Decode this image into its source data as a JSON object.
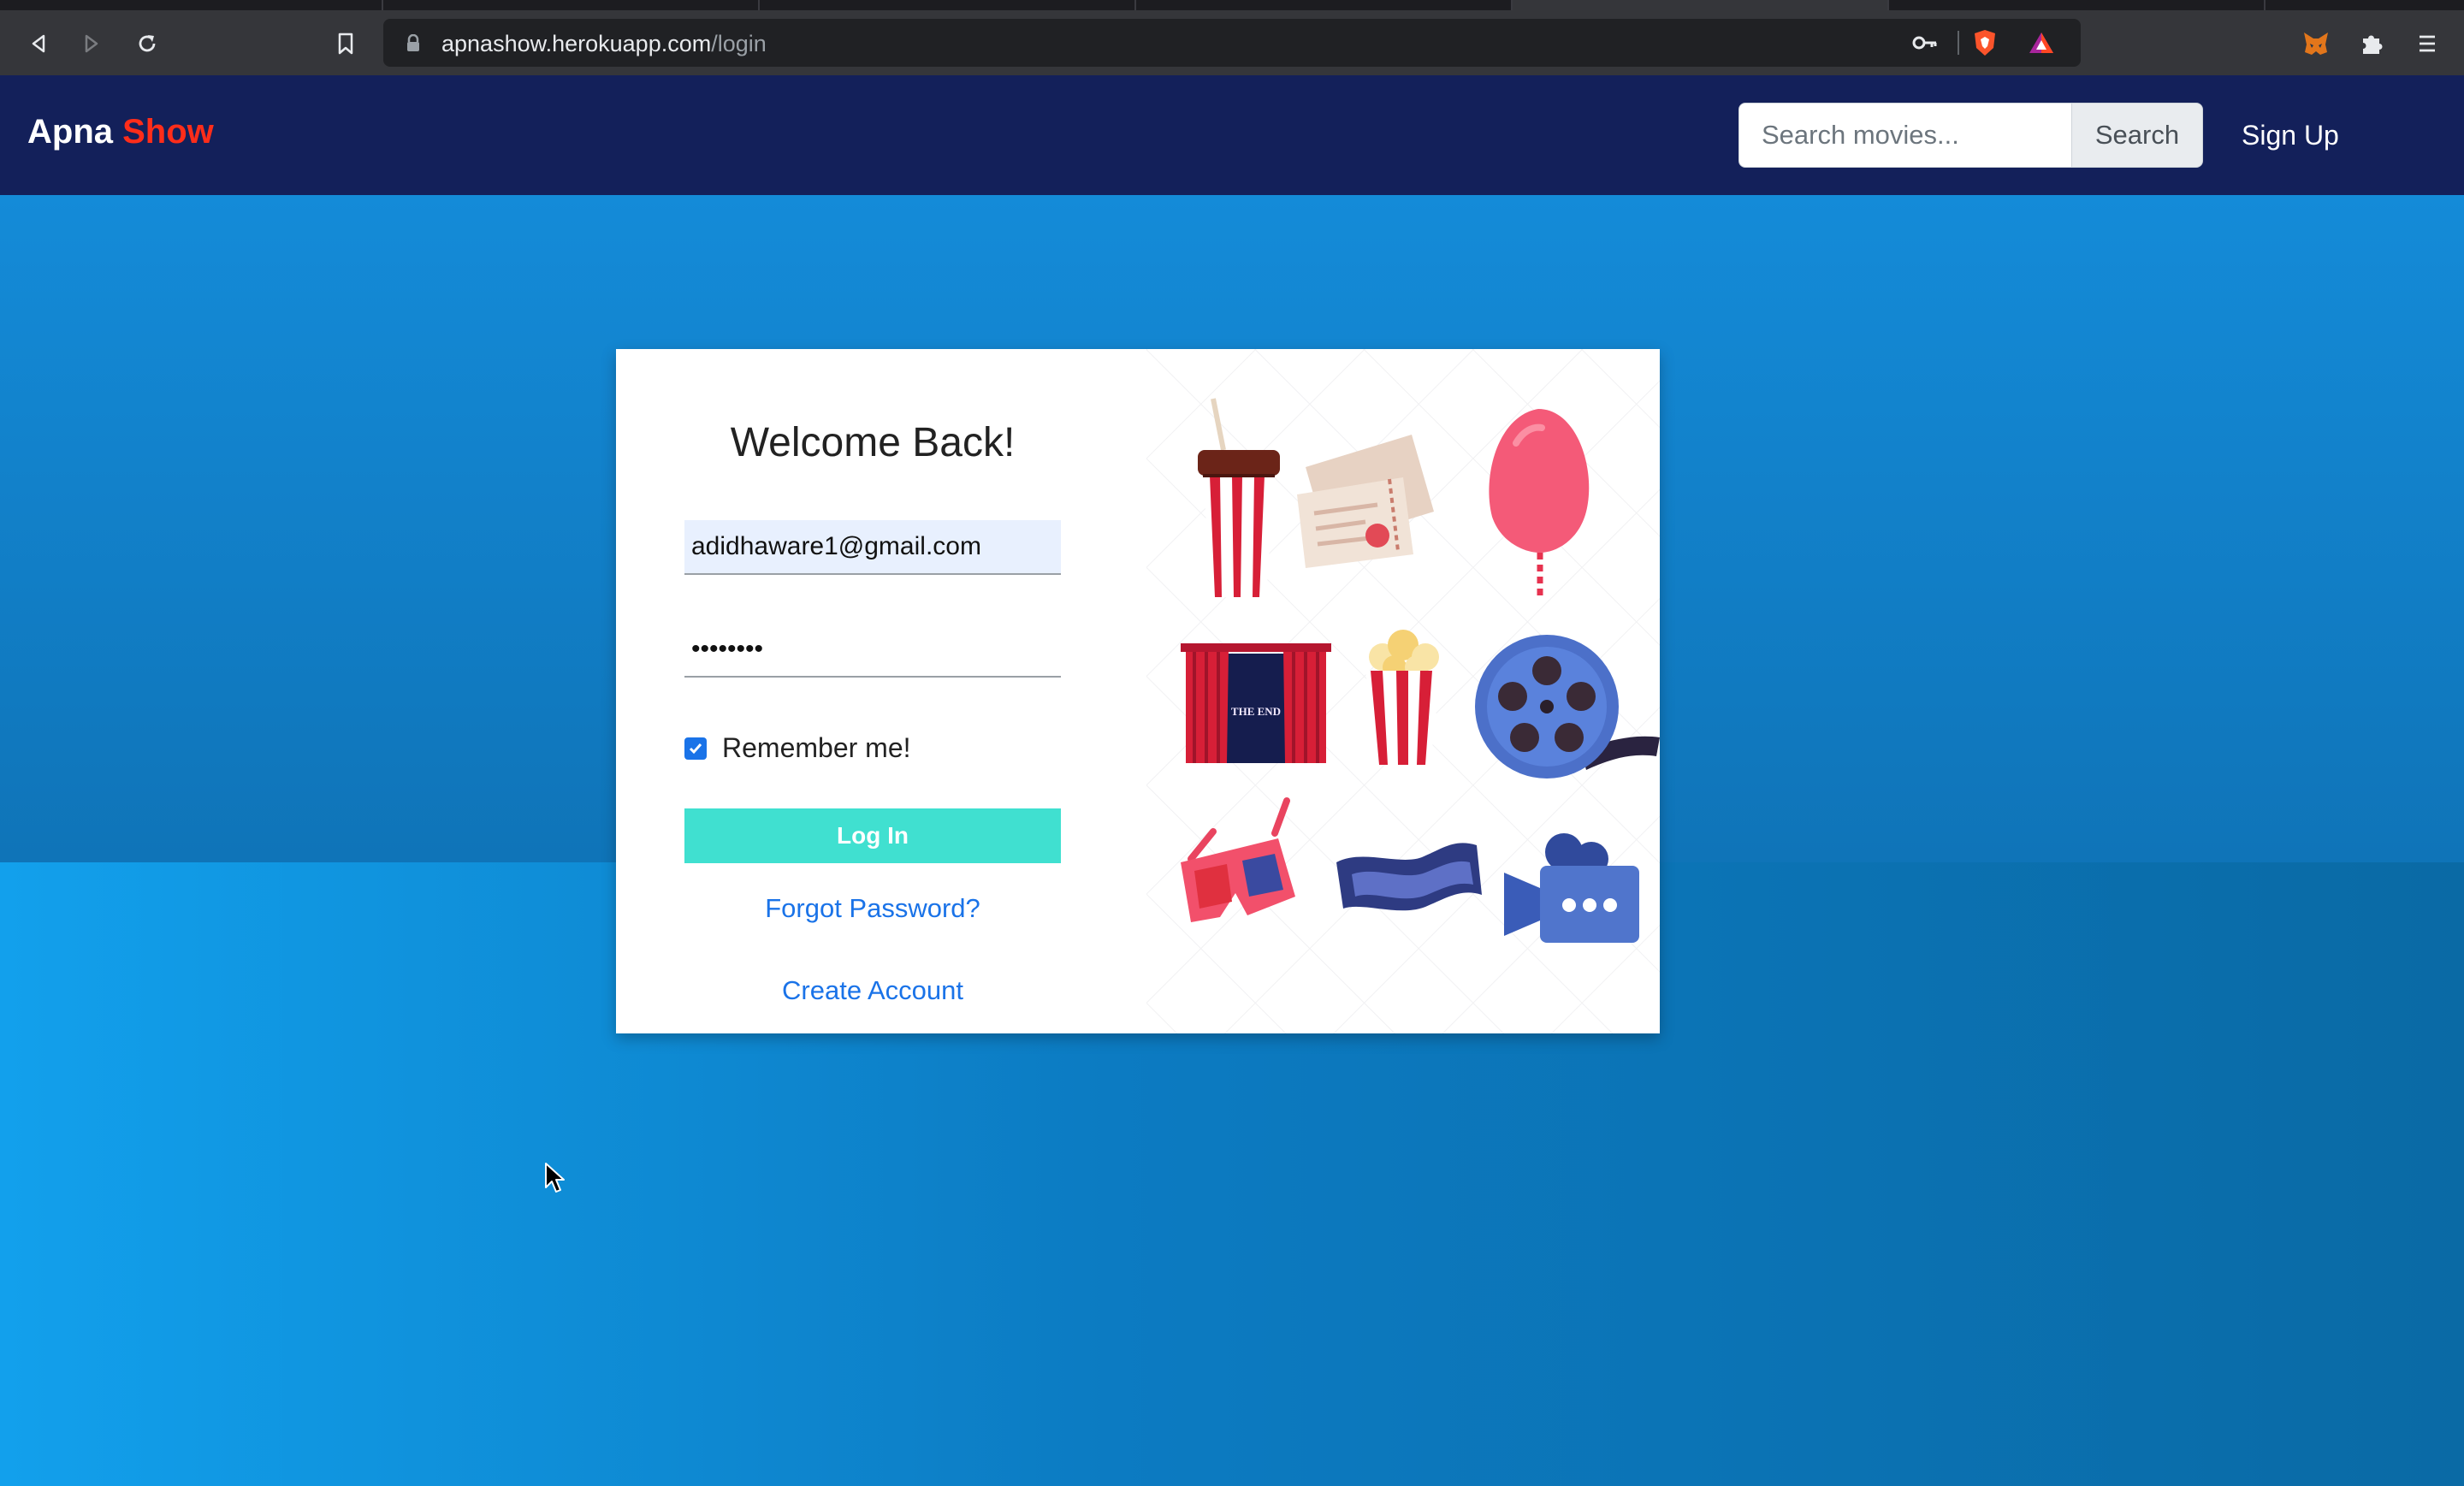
{
  "browser": {
    "url_host": "apnashow.herokuapp.com",
    "url_path": "/login",
    "icons": [
      "back-icon",
      "forward-icon",
      "reload-icon",
      "bookmark-icon",
      "lock-icon",
      "key-icon",
      "brave-shield-icon",
      "brave-rewards-icon",
      "metamask-icon",
      "extensions-icon",
      "menu-icon"
    ]
  },
  "navbar": {
    "brand_part1": "Apna",
    "brand_part2": "Show",
    "search_placeholder": "Search movies...",
    "search_button": "Search",
    "signup": "Sign Up"
  },
  "login": {
    "title": "Welcome Back!",
    "email_value": "adidhaware1@gmail.com",
    "password_value": "12345678",
    "remember_label": "Remember me!",
    "remember_checked": true,
    "login_button": "Log In",
    "forgot_link": "Forgot Password?",
    "create_link": "Create Account"
  },
  "illustration": {
    "curtain_text": "THE END",
    "items": [
      "soda-cup-icon",
      "tickets-icon",
      "cotton-candy-icon",
      "curtain-icon",
      "popcorn-icon",
      "film-reel-icon",
      "3d-glasses-icon",
      "film-strip-icon",
      "movie-camera-icon"
    ]
  },
  "colors": {
    "navbar": "#13205a",
    "brand_accent": "#ff2d1a",
    "background": "#0c86cf",
    "login_button": "#40e0d0",
    "link": "#1a73e8"
  }
}
